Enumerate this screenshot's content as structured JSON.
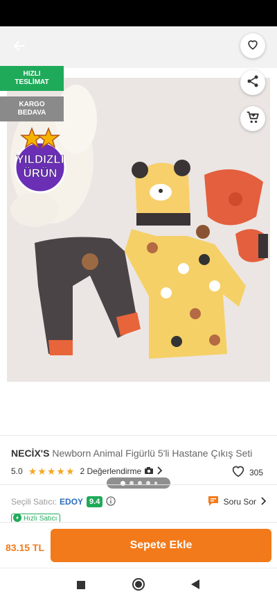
{
  "header": {
    "back_icon": "arrow-left-icon",
    "favorite_icon": "heart-icon",
    "share_icon": "share-icon",
    "cart_icon": "cart-icon"
  },
  "badges": {
    "fast_line1": "HIZLI",
    "fast_line2": "TESLİMAT",
    "cargo_line1": "KARGO",
    "cargo_line2": "BEDAVA",
    "star_line1": "YILDIZLI",
    "star_line2": "ÜRÜN"
  },
  "gallery": {
    "image_count": 5,
    "active_index": 0
  },
  "product": {
    "brand": "NECİX'S",
    "name": "Newborn Animal Figürlü 5'li Hastane Çıkış Seti",
    "rating": "5.0",
    "stars": 5,
    "reviews_label": "2 Değerlendirme",
    "favorites": "305"
  },
  "seller": {
    "label": "Seçili Satıcı:",
    "name": "EDOY",
    "score": "9.4",
    "ask_label": "Soru Sor",
    "fast_seller_label": "Hızlı Satıcı"
  },
  "purchase": {
    "price": "83.15 TL",
    "button_label": "Sepete Ekle"
  },
  "colors": {
    "accent": "#f27a1a",
    "green": "#1faa5a",
    "seller_blue": "#2a6dbf",
    "star": "#f5a623"
  }
}
